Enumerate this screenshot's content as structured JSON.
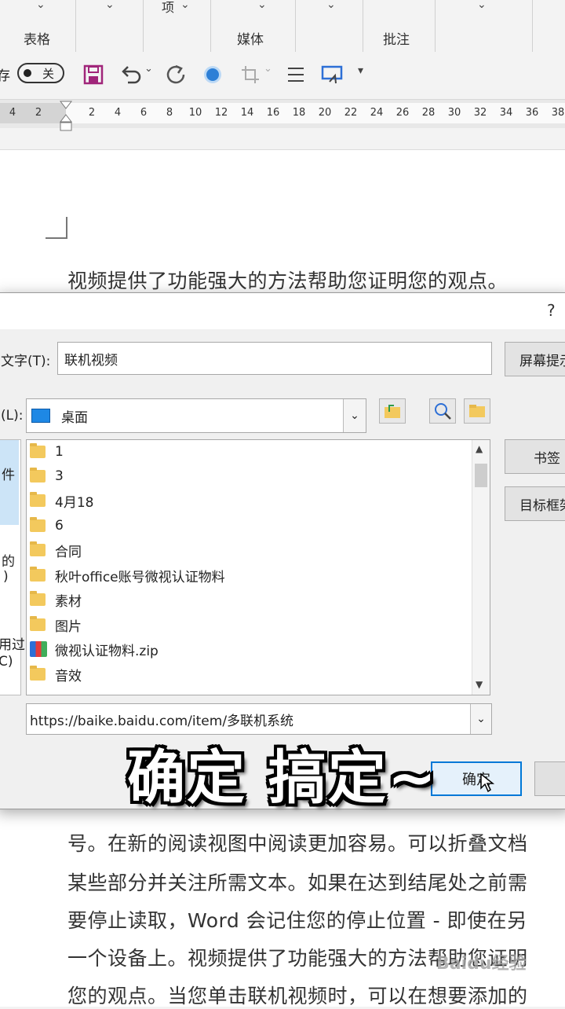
{
  "ribbon": {
    "groups": [
      {
        "label": "表格",
        "top": ""
      },
      {
        "label": "",
        "top": "项"
      },
      {
        "label": "媒体",
        "top": ""
      },
      {
        "label": "",
        "top": ""
      },
      {
        "label": "批注",
        "top": ""
      }
    ]
  },
  "toolbar": {
    "left_fragment": "存",
    "toggle_label": "关"
  },
  "ruler": {
    "ticks": [
      "4",
      "2",
      "2",
      "4",
      "6",
      "8",
      "10",
      "12",
      "14",
      "16",
      "18",
      "20",
      "22",
      "24",
      "26",
      "28",
      "30",
      "32",
      "34",
      "36",
      "38"
    ]
  },
  "document": {
    "lines": [
      "视频提供了功能强大的方法帮助您证明您的观点。",
      "号。在新的阅读视图中阅读更加容易。可以折叠文档",
      "某些部分并关注所需文本。如果在达到结尾处之前需",
      "要停止读取，Word 会记住您的停止位置 - 即使在另",
      "一个设备上。视频提供了功能强大的方法帮助您证明",
      "您的观点。当您单击联机视频时，可以在想要添加的"
    ]
  },
  "dialog": {
    "help": "?",
    "display_text_label": "文字(T):",
    "display_text_value": "联机视频",
    "screen_tip_button": "屏幕提示",
    "lookin_label": "(L):",
    "lookin_value": "桌面",
    "left_labels": [
      "件",
      "的",
      ")",
      "用过",
      "C)"
    ],
    "files": [
      {
        "name": "1",
        "type": "folder"
      },
      {
        "name": "3",
        "type": "folder"
      },
      {
        "name": "4月18",
        "type": "folder"
      },
      {
        "name": "6",
        "type": "folder"
      },
      {
        "name": "合同",
        "type": "folder"
      },
      {
        "name": "秋叶office账号微视认证物料",
        "type": "folder"
      },
      {
        "name": "素材",
        "type": "folder"
      },
      {
        "name": "图片",
        "type": "folder"
      },
      {
        "name": "微视认证物料.zip",
        "type": "zip"
      },
      {
        "name": "音效",
        "type": "folder"
      }
    ],
    "bookmark_button": "书签",
    "target_frame_button": "目标框架",
    "address_value": "https://baike.baidu.com/item/多联机系统",
    "ok_button": "确定"
  },
  "caption": "确定 搞定~",
  "watermark": "Baidu经验"
}
